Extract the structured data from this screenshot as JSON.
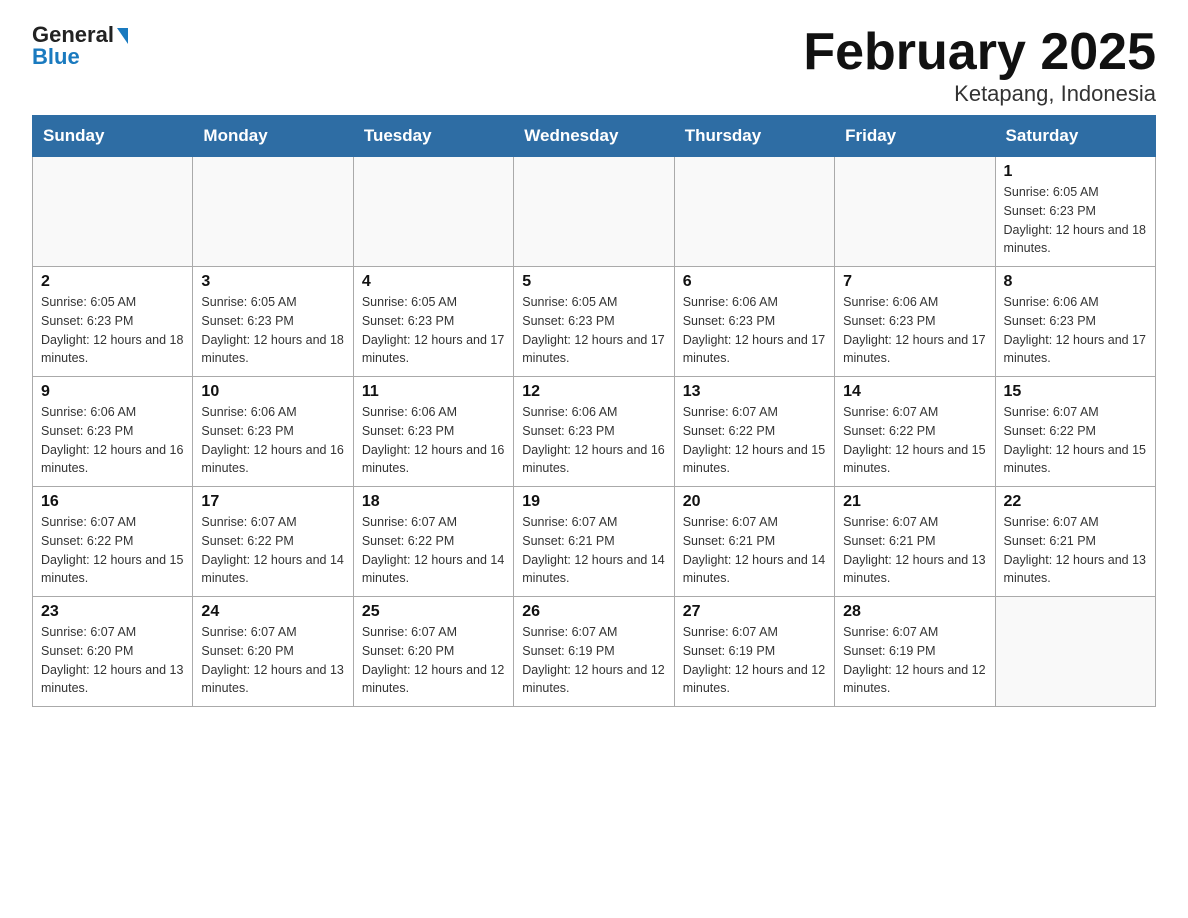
{
  "header": {
    "logo_main": "General",
    "logo_blue": "Blue",
    "title": "February 2025",
    "subtitle": "Ketapang, Indonesia"
  },
  "days_of_week": [
    "Sunday",
    "Monday",
    "Tuesday",
    "Wednesday",
    "Thursday",
    "Friday",
    "Saturday"
  ],
  "weeks": [
    [
      {
        "day": "",
        "sunrise": "",
        "sunset": "",
        "daylight": ""
      },
      {
        "day": "",
        "sunrise": "",
        "sunset": "",
        "daylight": ""
      },
      {
        "day": "",
        "sunrise": "",
        "sunset": "",
        "daylight": ""
      },
      {
        "day": "",
        "sunrise": "",
        "sunset": "",
        "daylight": ""
      },
      {
        "day": "",
        "sunrise": "",
        "sunset": "",
        "daylight": ""
      },
      {
        "day": "",
        "sunrise": "",
        "sunset": "",
        "daylight": ""
      },
      {
        "day": "1",
        "sunrise": "Sunrise: 6:05 AM",
        "sunset": "Sunset: 6:23 PM",
        "daylight": "Daylight: 12 hours and 18 minutes."
      }
    ],
    [
      {
        "day": "2",
        "sunrise": "Sunrise: 6:05 AM",
        "sunset": "Sunset: 6:23 PM",
        "daylight": "Daylight: 12 hours and 18 minutes."
      },
      {
        "day": "3",
        "sunrise": "Sunrise: 6:05 AM",
        "sunset": "Sunset: 6:23 PM",
        "daylight": "Daylight: 12 hours and 18 minutes."
      },
      {
        "day": "4",
        "sunrise": "Sunrise: 6:05 AM",
        "sunset": "Sunset: 6:23 PM",
        "daylight": "Daylight: 12 hours and 17 minutes."
      },
      {
        "day": "5",
        "sunrise": "Sunrise: 6:05 AM",
        "sunset": "Sunset: 6:23 PM",
        "daylight": "Daylight: 12 hours and 17 minutes."
      },
      {
        "day": "6",
        "sunrise": "Sunrise: 6:06 AM",
        "sunset": "Sunset: 6:23 PM",
        "daylight": "Daylight: 12 hours and 17 minutes."
      },
      {
        "day": "7",
        "sunrise": "Sunrise: 6:06 AM",
        "sunset": "Sunset: 6:23 PM",
        "daylight": "Daylight: 12 hours and 17 minutes."
      },
      {
        "day": "8",
        "sunrise": "Sunrise: 6:06 AM",
        "sunset": "Sunset: 6:23 PM",
        "daylight": "Daylight: 12 hours and 17 minutes."
      }
    ],
    [
      {
        "day": "9",
        "sunrise": "Sunrise: 6:06 AM",
        "sunset": "Sunset: 6:23 PM",
        "daylight": "Daylight: 12 hours and 16 minutes."
      },
      {
        "day": "10",
        "sunrise": "Sunrise: 6:06 AM",
        "sunset": "Sunset: 6:23 PM",
        "daylight": "Daylight: 12 hours and 16 minutes."
      },
      {
        "day": "11",
        "sunrise": "Sunrise: 6:06 AM",
        "sunset": "Sunset: 6:23 PM",
        "daylight": "Daylight: 12 hours and 16 minutes."
      },
      {
        "day": "12",
        "sunrise": "Sunrise: 6:06 AM",
        "sunset": "Sunset: 6:23 PM",
        "daylight": "Daylight: 12 hours and 16 minutes."
      },
      {
        "day": "13",
        "sunrise": "Sunrise: 6:07 AM",
        "sunset": "Sunset: 6:22 PM",
        "daylight": "Daylight: 12 hours and 15 minutes."
      },
      {
        "day": "14",
        "sunrise": "Sunrise: 6:07 AM",
        "sunset": "Sunset: 6:22 PM",
        "daylight": "Daylight: 12 hours and 15 minutes."
      },
      {
        "day": "15",
        "sunrise": "Sunrise: 6:07 AM",
        "sunset": "Sunset: 6:22 PM",
        "daylight": "Daylight: 12 hours and 15 minutes."
      }
    ],
    [
      {
        "day": "16",
        "sunrise": "Sunrise: 6:07 AM",
        "sunset": "Sunset: 6:22 PM",
        "daylight": "Daylight: 12 hours and 15 minutes."
      },
      {
        "day": "17",
        "sunrise": "Sunrise: 6:07 AM",
        "sunset": "Sunset: 6:22 PM",
        "daylight": "Daylight: 12 hours and 14 minutes."
      },
      {
        "day": "18",
        "sunrise": "Sunrise: 6:07 AM",
        "sunset": "Sunset: 6:22 PM",
        "daylight": "Daylight: 12 hours and 14 minutes."
      },
      {
        "day": "19",
        "sunrise": "Sunrise: 6:07 AM",
        "sunset": "Sunset: 6:21 PM",
        "daylight": "Daylight: 12 hours and 14 minutes."
      },
      {
        "day": "20",
        "sunrise": "Sunrise: 6:07 AM",
        "sunset": "Sunset: 6:21 PM",
        "daylight": "Daylight: 12 hours and 14 minutes."
      },
      {
        "day": "21",
        "sunrise": "Sunrise: 6:07 AM",
        "sunset": "Sunset: 6:21 PM",
        "daylight": "Daylight: 12 hours and 13 minutes."
      },
      {
        "day": "22",
        "sunrise": "Sunrise: 6:07 AM",
        "sunset": "Sunset: 6:21 PM",
        "daylight": "Daylight: 12 hours and 13 minutes."
      }
    ],
    [
      {
        "day": "23",
        "sunrise": "Sunrise: 6:07 AM",
        "sunset": "Sunset: 6:20 PM",
        "daylight": "Daylight: 12 hours and 13 minutes."
      },
      {
        "day": "24",
        "sunrise": "Sunrise: 6:07 AM",
        "sunset": "Sunset: 6:20 PM",
        "daylight": "Daylight: 12 hours and 13 minutes."
      },
      {
        "day": "25",
        "sunrise": "Sunrise: 6:07 AM",
        "sunset": "Sunset: 6:20 PM",
        "daylight": "Daylight: 12 hours and 12 minutes."
      },
      {
        "day": "26",
        "sunrise": "Sunrise: 6:07 AM",
        "sunset": "Sunset: 6:19 PM",
        "daylight": "Daylight: 12 hours and 12 minutes."
      },
      {
        "day": "27",
        "sunrise": "Sunrise: 6:07 AM",
        "sunset": "Sunset: 6:19 PM",
        "daylight": "Daylight: 12 hours and 12 minutes."
      },
      {
        "day": "28",
        "sunrise": "Sunrise: 6:07 AM",
        "sunset": "Sunset: 6:19 PM",
        "daylight": "Daylight: 12 hours and 12 minutes."
      },
      {
        "day": "",
        "sunrise": "",
        "sunset": "",
        "daylight": ""
      }
    ]
  ]
}
